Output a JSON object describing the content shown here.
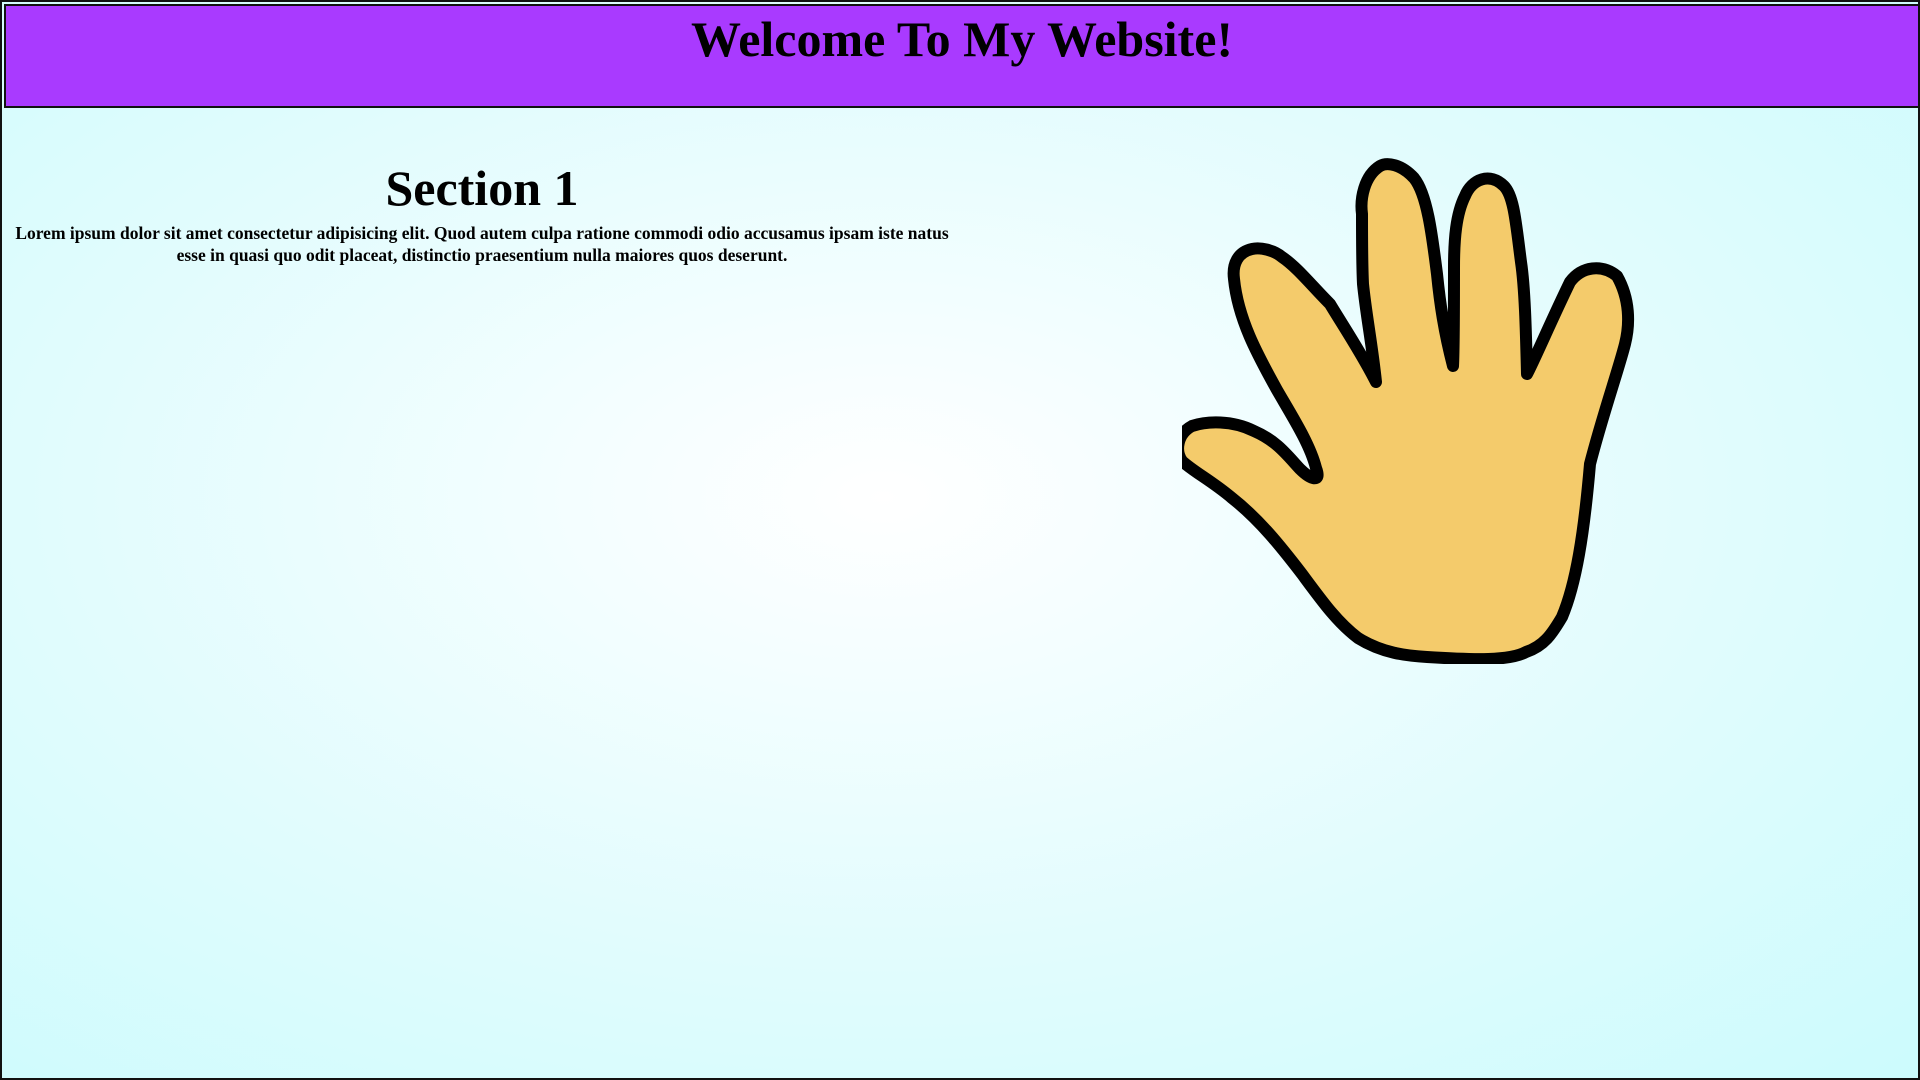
{
  "header": {
    "title": "Welcome To My Website!"
  },
  "section": {
    "heading": "Section 1",
    "body": "Lorem ipsum dolor sit amet consectetur adipisicing elit. Quod autem culpa ratione commodi odio accusamus ipsam iste natus esse in quasi quo odit placeat, distinctio praesentium nulla maiores quos deserunt."
  },
  "image": {
    "icon": "waving-hand-icon",
    "fill_color": "#f4cb6b",
    "outline_color": "#000000"
  },
  "colors": {
    "header_background": "#a93aff",
    "page_background_center": "#ffffff",
    "page_background_edge": "#ccfbfd"
  }
}
